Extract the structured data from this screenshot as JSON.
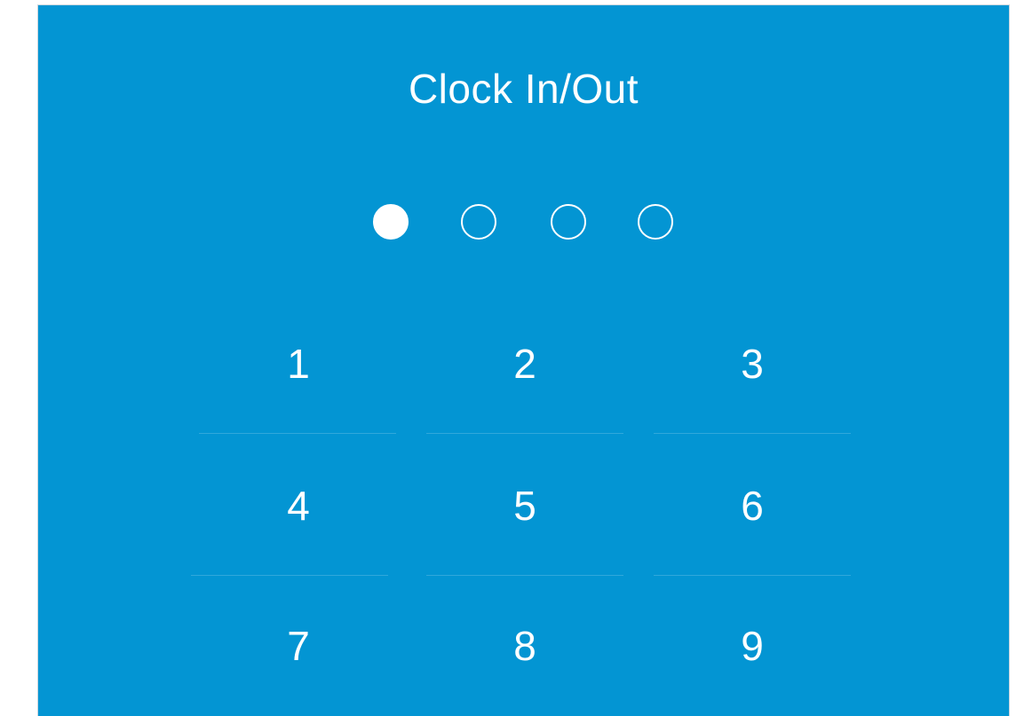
{
  "title": "Clock In/Out",
  "pin": {
    "length": 4,
    "entered": 1
  },
  "keypad": {
    "keys": [
      "1",
      "2",
      "3",
      "4",
      "5",
      "6",
      "7",
      "8",
      "9"
    ]
  },
  "colors": {
    "background": "#0395d3",
    "foreground": "#ffffff"
  }
}
